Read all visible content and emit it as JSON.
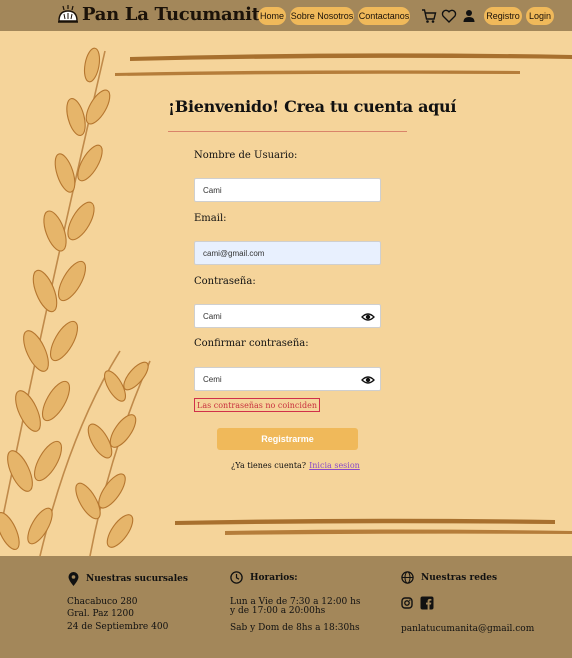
{
  "header": {
    "brand": "Pan La Tucumanita",
    "nav": [
      "Home",
      "Sobre Nosotros",
      "Contactanos"
    ],
    "auth": [
      "Registro",
      "Login"
    ],
    "icons": [
      "cart-icon",
      "heart-icon",
      "user-icon"
    ]
  },
  "form": {
    "title": "¡Bienvenido! Crea tu cuenta aquí",
    "username_label": "Nombre de Usuario:",
    "username_value": "Cami",
    "email_label": "Email:",
    "email_value": "cami@gmail.com",
    "password_label": "Contraseña:",
    "password_value": "Cami",
    "confirm_label": "Confirmar contraseña:",
    "confirm_value": "Cemi",
    "error": "Las contraseñas no coinciden",
    "submit": "Registrarme",
    "login_prompt": "¿Ya tienes cuenta?",
    "login_link": "Inicia sesion"
  },
  "footer": {
    "branches_title": "Nuestras sucursales",
    "branches": [
      "Chacabuco 280",
      "Gral. Paz 1200",
      "24 de Septiembre 400"
    ],
    "hours_title": "Horarios:",
    "hours_line1": "Lun a Vie de 7:30 a 12:00 hs",
    "hours_line2": "y de 17:00 a 20:00hs",
    "hours_line3": "Sab y Dom de 8hs a 18:30hs",
    "social_title": "Nuestras redes",
    "social_icons": [
      "instagram-icon",
      "facebook-icon"
    ],
    "handle": "panlatucumanita@gmail.com"
  },
  "colors": {
    "header_bg": "#a3875a",
    "page_bg": "#f5d49a",
    "accent": "#f0b95a",
    "error": "#c8303e"
  }
}
